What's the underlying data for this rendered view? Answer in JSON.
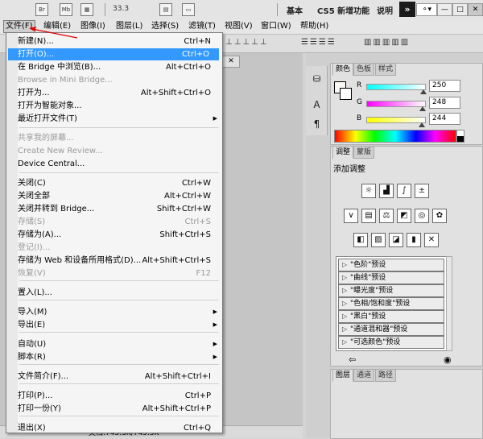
{
  "app_bar": {
    "icons": [
      "Br",
      "Mb"
    ],
    "zoom": "33.3",
    "workspaces": [
      "基本",
      "CS5 新增功能",
      "说明"
    ],
    "more": "»",
    "search": "⚬▾",
    "window_controls": [
      "—",
      "□",
      "✕"
    ]
  },
  "menubar": {
    "items": [
      "文件(F)",
      "编辑(E)",
      "图像(I)",
      "图层(L)",
      "选择(S)",
      "滤镜(T)",
      "视图(V)",
      "窗口(W)",
      "帮助(H)"
    ]
  },
  "doc_tab_close": "✕",
  "file_menu": {
    "items": [
      {
        "label": "新建(N)...",
        "shortcut": "Ctrl+N",
        "state": "normal"
      },
      {
        "label": "打开(O)...",
        "shortcut": "Ctrl+O",
        "state": "highlight"
      },
      {
        "label": "在 Bridge 中浏览(B)...",
        "shortcut": "Alt+Ctrl+O",
        "state": "normal"
      },
      {
        "label": "Browse in Mini Bridge...",
        "shortcut": "",
        "state": "disabled"
      },
      {
        "label": "打开为...",
        "shortcut": "Alt+Shift+Ctrl+O",
        "state": "normal"
      },
      {
        "label": "打开为智能对象...",
        "shortcut": "",
        "state": "normal"
      },
      {
        "label": "最近打开文件(T)",
        "shortcut": "",
        "state": "submenu"
      },
      {
        "label": "共享我的屏幕...",
        "shortcut": "",
        "state": "disabled"
      },
      {
        "label": "Create New Review...",
        "shortcut": "",
        "state": "disabled"
      },
      {
        "label": "Device Central...",
        "shortcut": "",
        "state": "normal"
      },
      {
        "label": "关闭(C)",
        "shortcut": "Ctrl+W",
        "state": "normal"
      },
      {
        "label": "关闭全部",
        "shortcut": "Alt+Ctrl+W",
        "state": "normal"
      },
      {
        "label": "关闭并转到 Bridge...",
        "shortcut": "Shift+Ctrl+W",
        "state": "normal"
      },
      {
        "label": "存储(S)",
        "shortcut": "Ctrl+S",
        "state": "disabled"
      },
      {
        "label": "存储为(A)...",
        "shortcut": "Shift+Ctrl+S",
        "state": "normal"
      },
      {
        "label": "登记(I)...",
        "shortcut": "",
        "state": "disabled"
      },
      {
        "label": "存储为 Web 和设备所用格式(D)...",
        "shortcut": "Alt+Shift+Ctrl+S",
        "state": "normal"
      },
      {
        "label": "恢复(V)",
        "shortcut": "F12",
        "state": "disabled"
      },
      {
        "label": "置入(L)...",
        "shortcut": "",
        "state": "normal"
      },
      {
        "label": "导入(M)",
        "shortcut": "",
        "state": "submenu"
      },
      {
        "label": "导出(E)",
        "shortcut": "",
        "state": "submenu"
      },
      {
        "label": "自动(U)",
        "shortcut": "",
        "state": "submenu"
      },
      {
        "label": "脚本(R)",
        "shortcut": "",
        "state": "submenu"
      },
      {
        "label": "文件简介(F)...",
        "shortcut": "Alt+Shift+Ctrl+I",
        "state": "normal"
      },
      {
        "label": "打印(P)...",
        "shortcut": "Ctrl+P",
        "state": "normal"
      },
      {
        "label": "打印一份(Y)",
        "shortcut": "Alt+Shift+Ctrl+P",
        "state": "normal"
      },
      {
        "label": "退出(X)",
        "shortcut": "Ctrl+Q",
        "state": "normal"
      }
    ],
    "submenu_arrow": "▶"
  },
  "color_panel": {
    "tabs": [
      "颜色",
      "色板",
      "样式"
    ],
    "sliders": [
      {
        "label": "R",
        "value": "250",
        "level": 0.98,
        "gradient": "linear-gradient(to right,#00ffff,#ffffff)"
      },
      {
        "label": "G",
        "value": "248",
        "level": 0.97,
        "gradient": "linear-gradient(to right,#ff00ff,#ffffff)"
      },
      {
        "label": "B",
        "value": "244",
        "level": 0.96,
        "gradient": "linear-gradient(to right,#ffff00,#ffffff)"
      }
    ]
  },
  "adjust_panel": {
    "tabs": [
      "调整",
      "蒙版"
    ],
    "title": "添加调整",
    "presets": [
      "\"色阶\"预设",
      "\"曲线\"预设",
      "\"曝光度\"预设",
      "\"色相/饱和度\"预设",
      "\"黑白\"预设",
      "\"通道混和器\"预设",
      "\"可选颜色\"预设"
    ],
    "preset_arrow": "▷"
  },
  "layers_panel": {
    "tabs": [
      "图层",
      "通道",
      "路径"
    ]
  },
  "status": {
    "zoom": "33.33%",
    "doc_info": "文档:745.3K/745.3K"
  },
  "colors": {
    "highlight": "#3399ff",
    "annotation": "#e00000"
  }
}
